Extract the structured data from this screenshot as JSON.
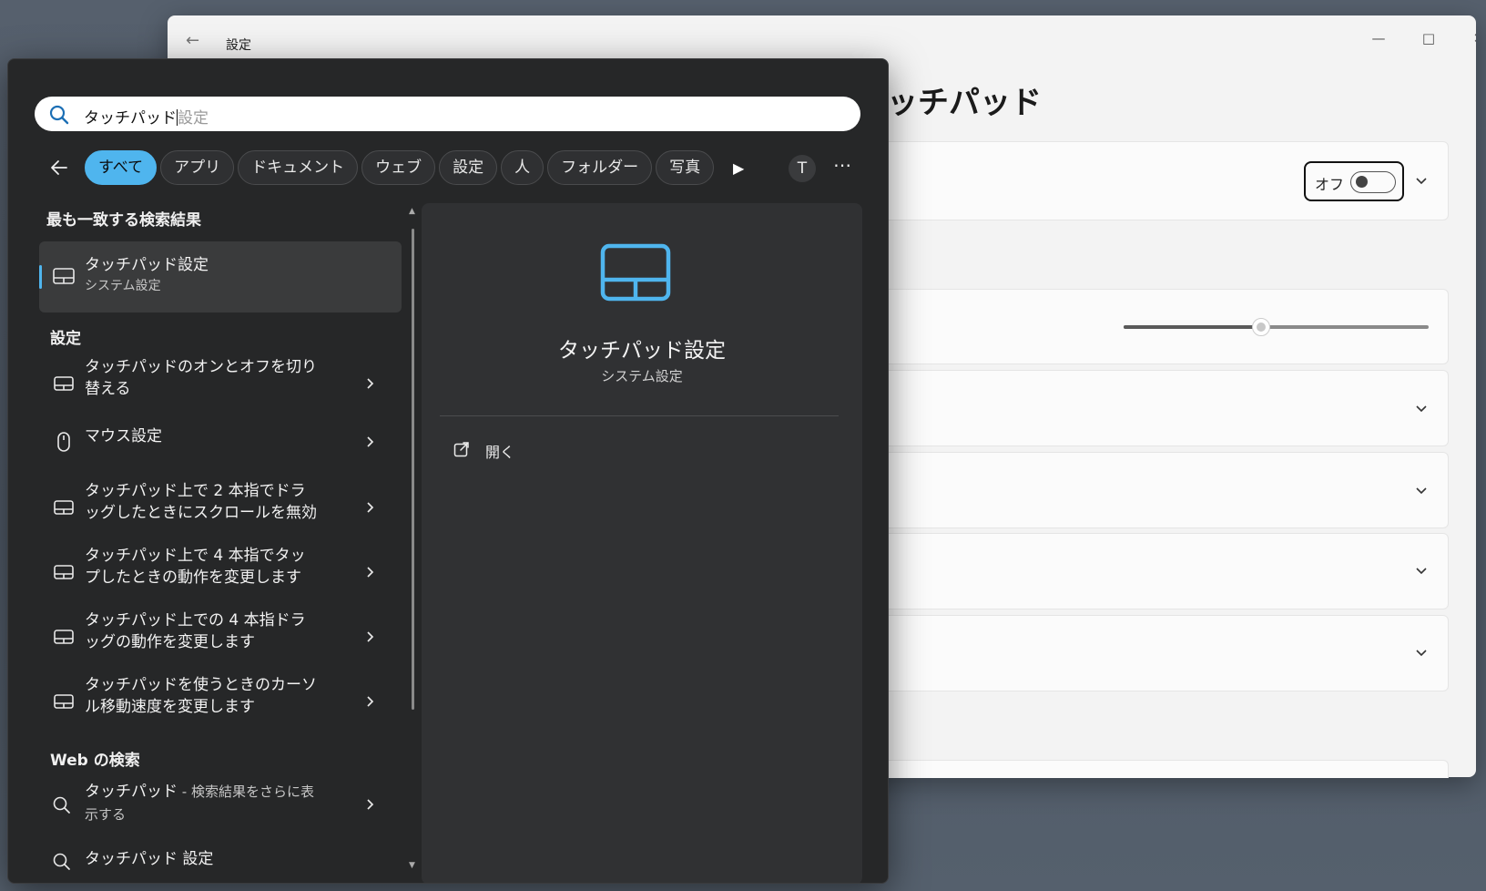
{
  "settings_window": {
    "title": "設定",
    "page_heading": "ッチパッド",
    "toggle_label": "オフ",
    "slider_value_fraction": 0.45
  },
  "search": {
    "query": "タッチパッド",
    "suggestion": "設定"
  },
  "filters": [
    "すべて",
    "アプリ",
    "ドキュメント",
    "ウェブ",
    "設定",
    "人",
    "フォルダー",
    "写真"
  ],
  "account_initial": "T",
  "sections": {
    "best_match": "最も一致する検索結果",
    "settings": "設定",
    "web": "Web の検索"
  },
  "best_match": {
    "title": "タッチパッド設定",
    "subtitle": "システム設定"
  },
  "settings_results": [
    {
      "line1": "タッチパッドのオンとオフを切り",
      "line2": "替える",
      "icon": "touchpad-icon"
    },
    {
      "line1": "マウス設定",
      "line2": "",
      "icon": "mouse-icon"
    },
    {
      "line1": "タッチパッド上で 2 本指でドラ",
      "line2": "ッグしたときにスクロールを無効",
      "icon": "touchpad-icon"
    },
    {
      "line1": "タッチパッド上で 4 本指でタッ",
      "line2": "プしたときの動作を変更します",
      "icon": "touchpad-icon"
    },
    {
      "line1": "タッチパッド上での 4 本指ドラ",
      "line2": "ッグの動作を変更します",
      "icon": "touchpad-icon"
    },
    {
      "line1": "タッチパッドを使うときのカーソ",
      "line2": "ル移動速度を変更します",
      "icon": "touchpad-icon"
    }
  ],
  "web_result": {
    "term": "タッチパッド",
    "desc": " - 検索結果をさらに表",
    "line2": "示する"
  },
  "web_result_2": {
    "term": "タッチパッド 設定"
  },
  "preview": {
    "title": "タッチパッド設定",
    "subtitle": "システム設定",
    "open_label": "開く"
  },
  "colors": {
    "accent": "#4fb5ee",
    "panel": "#262728",
    "preview": "#303133"
  }
}
